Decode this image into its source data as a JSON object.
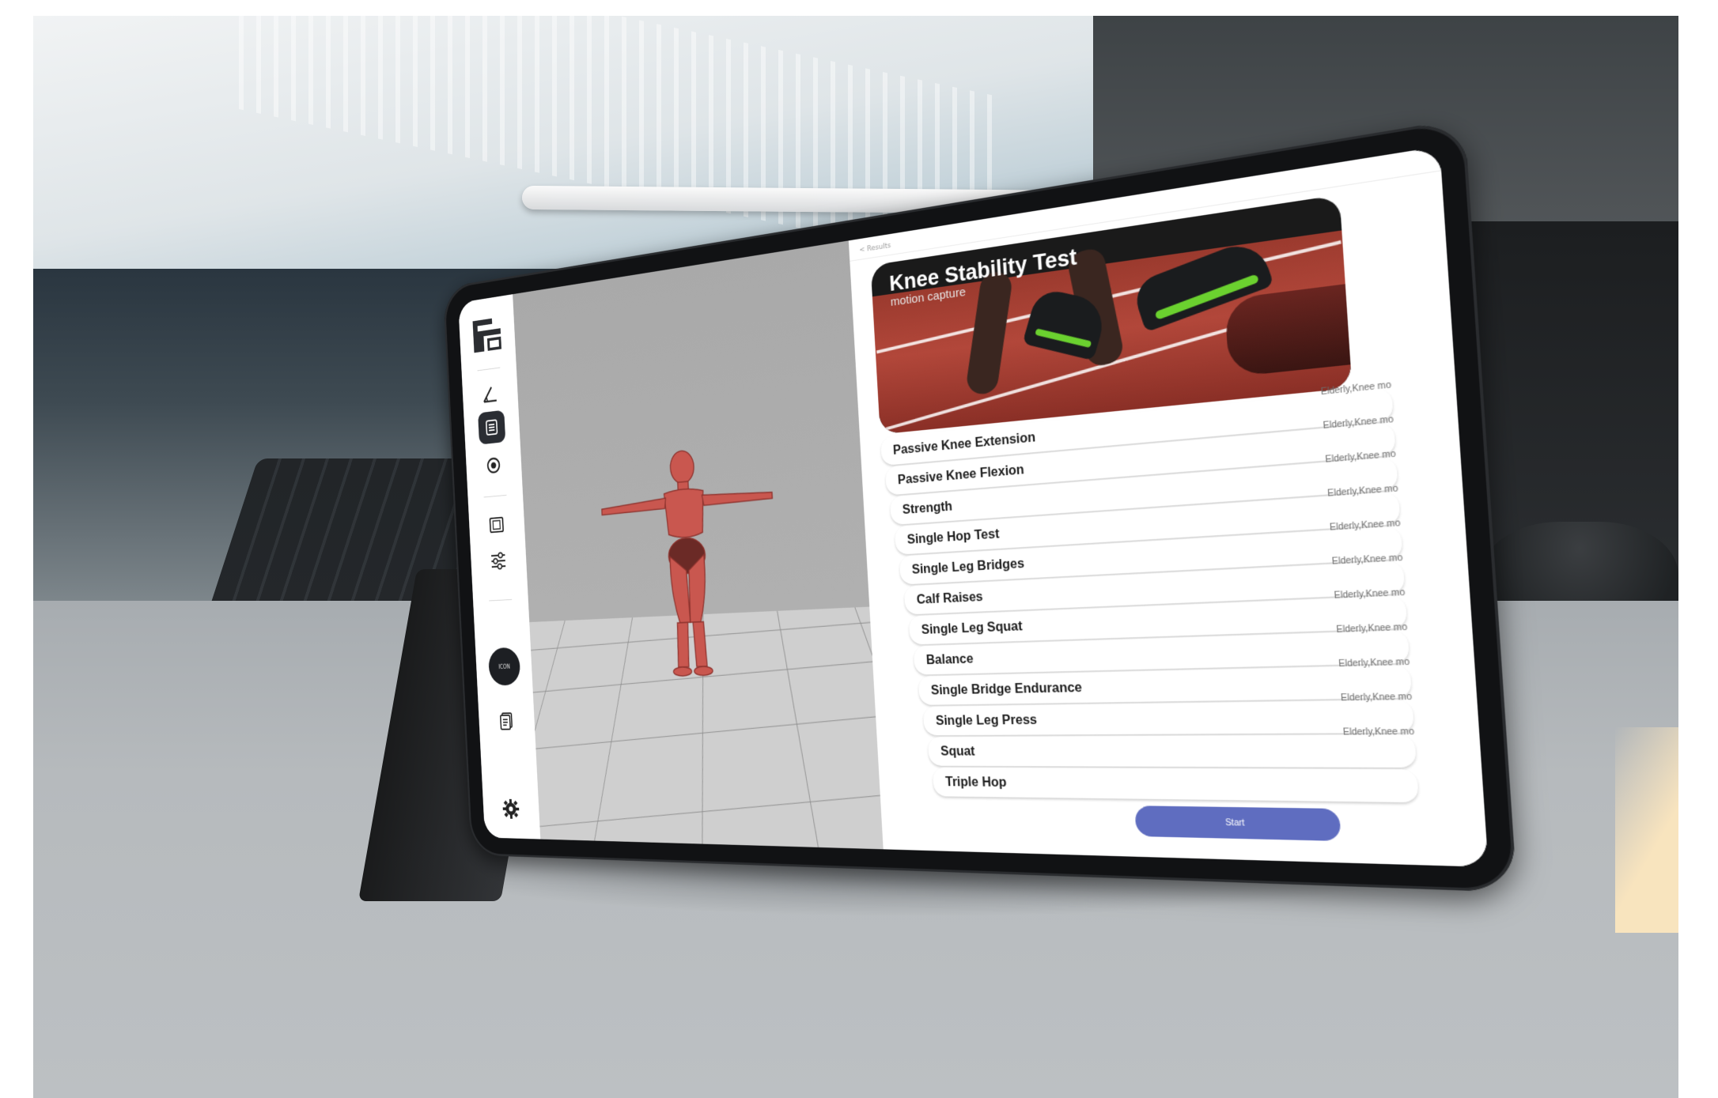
{
  "sidebar": {
    "icons": [
      {
        "name": "logo-icon"
      },
      {
        "name": "angle-measure-icon"
      },
      {
        "name": "list-icon"
      },
      {
        "name": "record-icon"
      },
      {
        "name": "media-frame-icon"
      },
      {
        "name": "sliders-icon"
      },
      {
        "name": "document-icon"
      },
      {
        "name": "gear-icon"
      }
    ],
    "circle_button_label": "ICON"
  },
  "panel": {
    "breadcrumb": "< Results",
    "hero": {
      "title": "Knee Stability Test",
      "subtitle": "motion capture"
    },
    "exercises": [
      {
        "label": "Passive Knee Extension",
        "tag": "Elderly,Knee mo"
      },
      {
        "label": "Passive Knee Flexion",
        "tag": "Elderly,Knee mo"
      },
      {
        "label": "Strength",
        "tag": "Elderly,Knee mo"
      },
      {
        "label": "Single Hop Test",
        "tag": "Elderly,Knee mo"
      },
      {
        "label": "Single Leg Bridges",
        "tag": "Elderly,Knee mo"
      },
      {
        "label": "Calf Raises",
        "tag": "Elderly,Knee mo"
      },
      {
        "label": "Single Leg Squat",
        "tag": "Elderly,Knee mo"
      },
      {
        "label": "Balance",
        "tag": "Elderly,Knee mo"
      },
      {
        "label": "Single Bridge Endurance",
        "tag": "Elderly,Knee mo"
      },
      {
        "label": "Single Leg Press",
        "tag": "Elderly,Knee mo"
      },
      {
        "label": "Squat",
        "tag": "Elderly,Knee mo"
      },
      {
        "label": "Triple Hop",
        "tag": ""
      }
    ],
    "start_label": "Start"
  },
  "colors": {
    "accent": "#5f6dc0",
    "figure": "#c9574f",
    "active_icon_bg": "#2a2d33"
  }
}
